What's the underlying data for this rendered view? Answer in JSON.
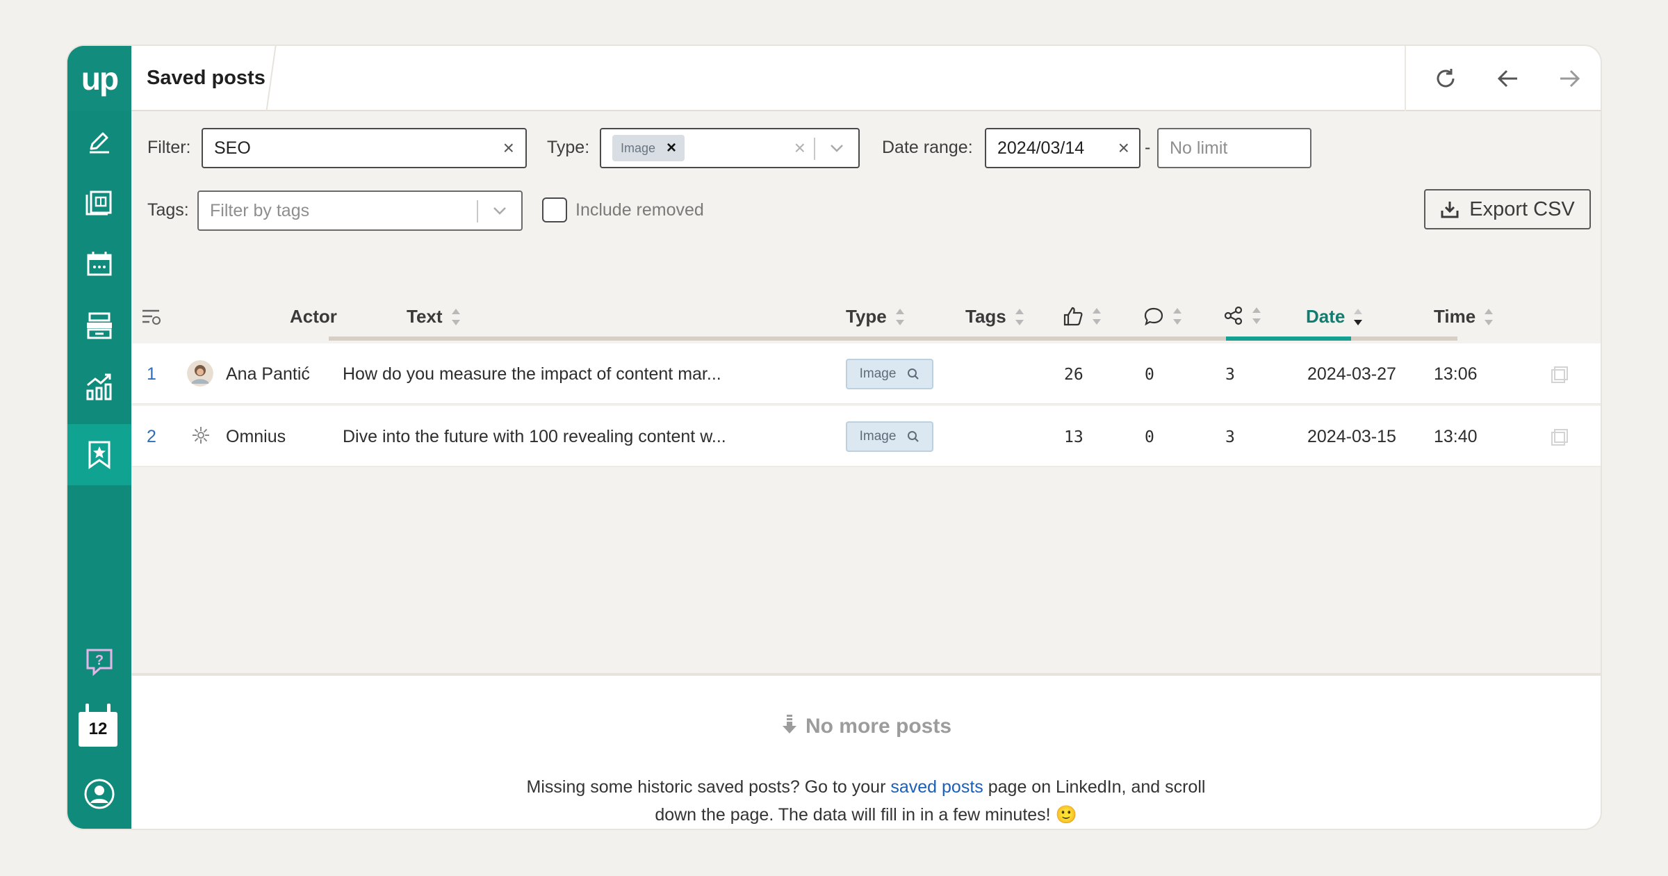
{
  "header": {
    "title": "Saved posts"
  },
  "sidebar": {
    "logo": "up",
    "calendar_day": "12"
  },
  "filters": {
    "filter_label": "Filter:",
    "filter_value": "SEO",
    "type_label": "Type:",
    "type_chip": "Image",
    "date_label": "Date range:",
    "date_from": "2024/03/14",
    "date_sep": "-",
    "date_to_placeholder": "No limit",
    "tags_label": "Tags:",
    "tags_placeholder": "Filter by tags",
    "include_removed": "Include removed",
    "export": "Export CSV"
  },
  "table": {
    "columns": {
      "actor": "Actor",
      "text": "Text",
      "type": "Type",
      "tags": "Tags",
      "date": "Date",
      "time": "Time"
    },
    "rows": [
      {
        "index": "1",
        "actor": "Ana Pantić",
        "text": "How do you measure the impact of content mar...",
        "type": "Image",
        "tags": "",
        "likes": "26",
        "comments": "0",
        "shares": "3",
        "date": "2024-03-27",
        "time": "13:06"
      },
      {
        "index": "2",
        "actor": "Omnius",
        "text": "Dive into the future with 100 revealing content w...",
        "type": "Image",
        "tags": "",
        "likes": "13",
        "comments": "0",
        "shares": "3",
        "date": "2024-03-15",
        "time": "13:40"
      }
    ]
  },
  "footer": {
    "no_more": "No more posts",
    "help_before": "Missing some historic saved posts? Go to your ",
    "help_link": "saved posts",
    "help_after": " page on LinkedIn, and scroll",
    "help_line2": "down the page. The data will fill in in a few minutes! 🙂"
  },
  "colors": {
    "sidebar": "#0f8a7b",
    "sidebar_active": "#11a392",
    "accent": "#15a091",
    "link": "#1a5fb8"
  }
}
